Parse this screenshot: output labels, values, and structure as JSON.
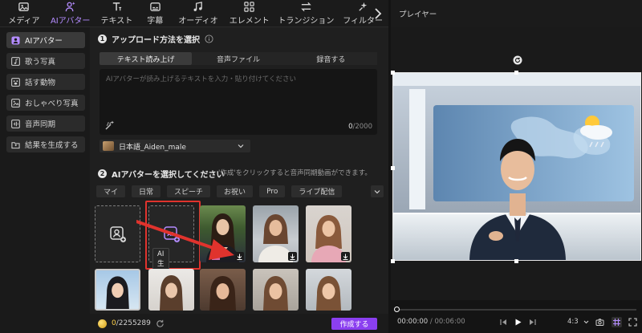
{
  "toolbar": {
    "items": [
      {
        "label": "メディア",
        "icon": "image-icon"
      },
      {
        "label": "AIアバター",
        "icon": "ai-avatar-icon"
      },
      {
        "label": "テキスト",
        "icon": "text-icon"
      },
      {
        "label": "字幕",
        "icon": "subtitle-icon"
      },
      {
        "label": "オーディオ",
        "icon": "music-icon"
      },
      {
        "label": "エレメント",
        "icon": "element-icon"
      },
      {
        "label": "トランジション",
        "icon": "transition-icon"
      },
      {
        "label": "フィルター",
        "icon": "filter-icon"
      }
    ],
    "active_index": 1,
    "accent": "#b48cff"
  },
  "sidebar": {
    "items": [
      {
        "label": "AIアバター"
      },
      {
        "label": "歌う写真"
      },
      {
        "label": "話す動物"
      },
      {
        "label": "おしゃべり写真"
      },
      {
        "label": "音声同期"
      },
      {
        "label": "結果を生成する"
      }
    ]
  },
  "step1": {
    "num": "1",
    "title": "アップロード方法を選択",
    "modes": [
      "テキスト読み上げ",
      "音声ファイル",
      "録音する"
    ],
    "placeholder": "AIアバターが読み上げるテキストを入力・貼り付けてください",
    "count_current": "0",
    "count_max": "/2000",
    "voice": "日本語_Aiden_male"
  },
  "step2": {
    "num": "2",
    "title": "AIアバターを選択してください",
    "note": "'作成'をクリックすると音声同期動画ができます。",
    "chips": [
      "マイ",
      "日常",
      "スピーチ",
      "お祝い",
      "Pro",
      "ライブ配信"
    ],
    "gen_tooltip": "AI生成"
  },
  "bottom": {
    "credits_current": "0",
    "credits_total": "/2255289",
    "create_label": "作成する",
    "create_color": "#8b3ff0"
  },
  "player": {
    "title": "プレイヤー",
    "time_current": "00:00:00",
    "time_total": "/ 00:06:00",
    "ratio": "4:3"
  },
  "highlight_color": "#e0332d"
}
